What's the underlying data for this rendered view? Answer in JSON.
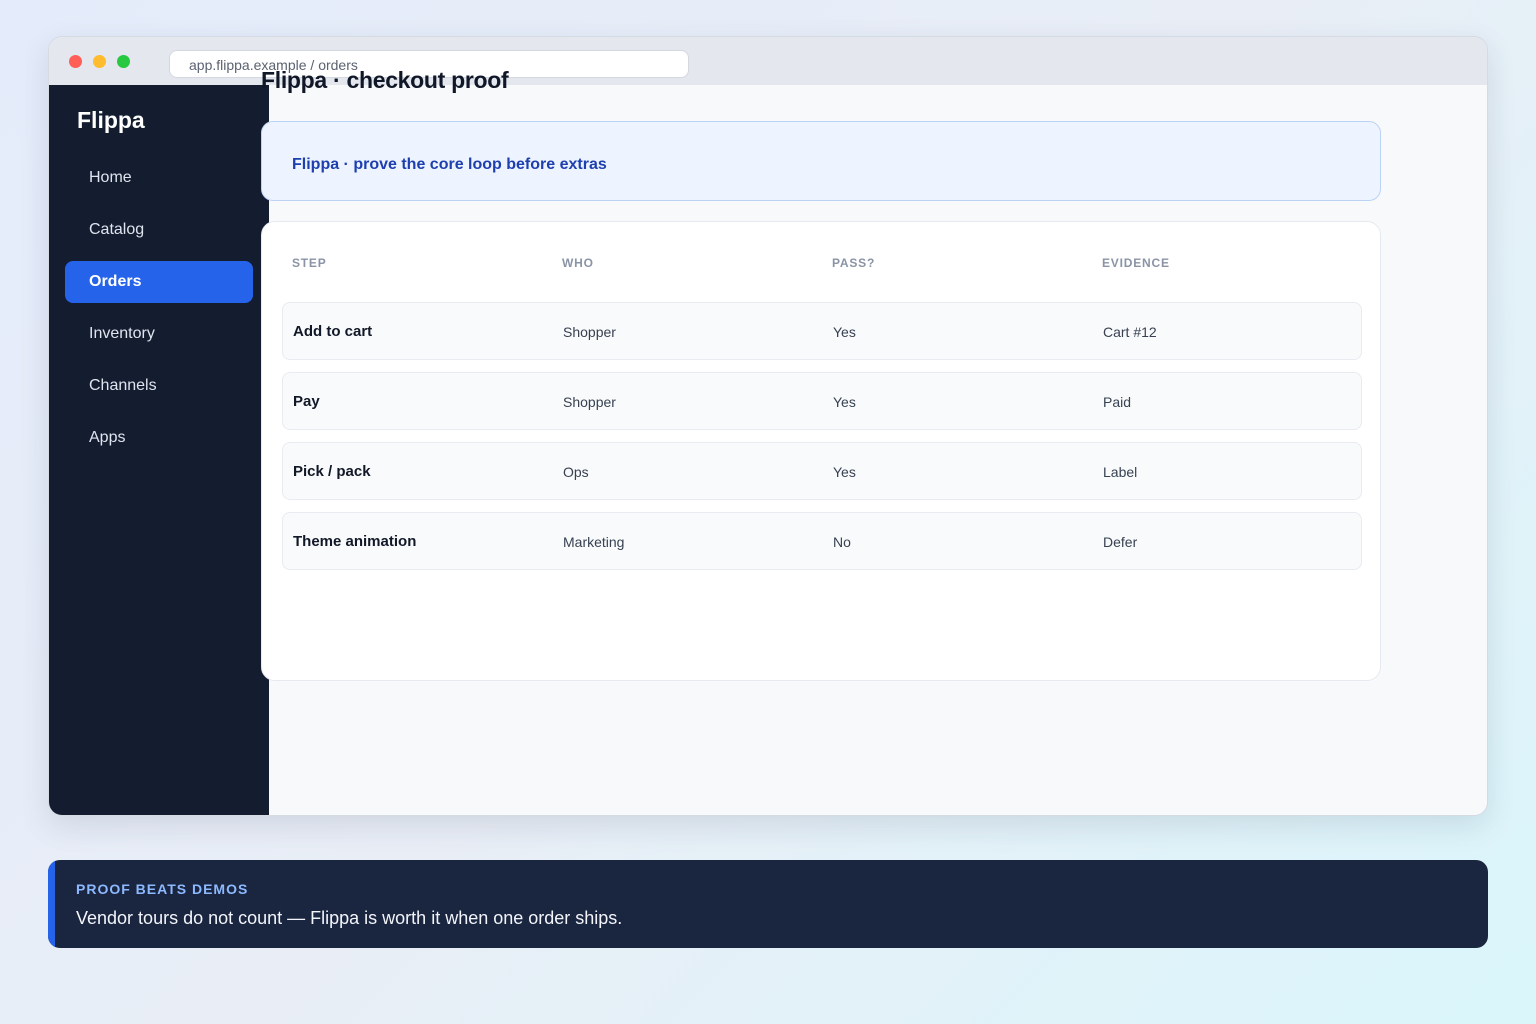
{
  "browser": {
    "url": "app.flippa.example / orders"
  },
  "sidebar": {
    "brand": "Flippa",
    "items": [
      {
        "label": "Home"
      },
      {
        "label": "Catalog"
      },
      {
        "label": "Orders"
      },
      {
        "label": "Inventory"
      },
      {
        "label": "Channels"
      },
      {
        "label": "Apps"
      }
    ],
    "active": "Orders"
  },
  "main": {
    "title": "Flippa · checkout proof",
    "banner": "Flippa · prove the core loop before extras",
    "table": {
      "headers": [
        "STEP",
        "WHO",
        "PASS?",
        "EVIDENCE"
      ],
      "rows": [
        {
          "step": "Add to cart",
          "who": "Shopper",
          "pass": "Yes",
          "evidence": "Cart #12"
        },
        {
          "step": "Pay",
          "who": "Shopper",
          "pass": "Yes",
          "evidence": "Paid"
        },
        {
          "step": "Pick / pack",
          "who": "Ops",
          "pass": "Yes",
          "evidence": "Label"
        },
        {
          "step": "Theme animation",
          "who": "Marketing",
          "pass": "No",
          "evidence": "Defer"
        }
      ]
    }
  },
  "callout": {
    "kicker": "PROOF BEATS DEMOS",
    "text": "Vendor tours do not count — Flippa is worth it when one order ships."
  },
  "colors": {
    "sidebar_bg": "#141c30",
    "accent": "#2563eb",
    "banner_text": "#1e40af",
    "callout_bg": "#1a2540"
  }
}
